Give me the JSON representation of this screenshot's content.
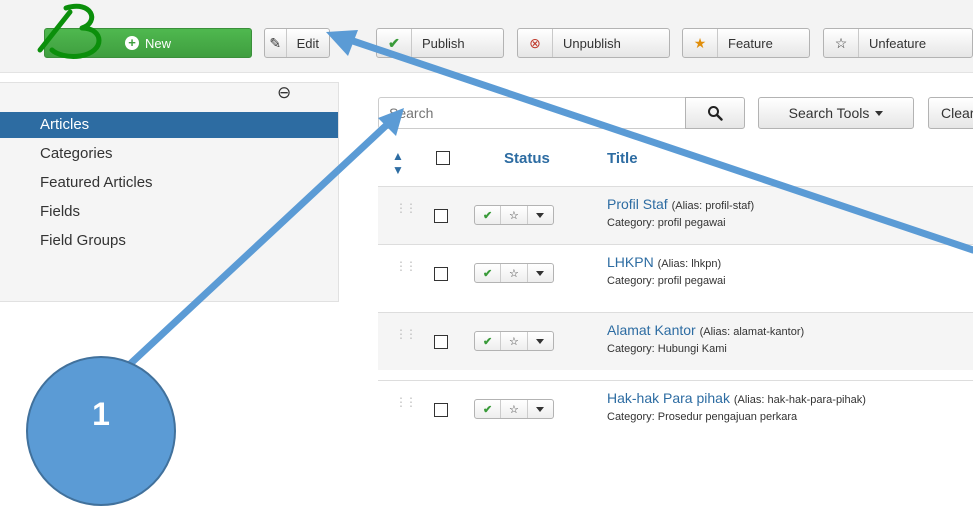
{
  "toolbar": {
    "new_label": "New",
    "edit_label": "Edit",
    "publish_label": "Publish",
    "unpublish_label": "Unpublish",
    "feature_label": "Feature",
    "unfeature_label": "Unfeature"
  },
  "sidebar": {
    "items": [
      {
        "label": "Articles",
        "active": true
      },
      {
        "label": "Categories"
      },
      {
        "label": "Featured Articles"
      },
      {
        "label": "Fields"
      },
      {
        "label": "Field Groups"
      }
    ]
  },
  "search": {
    "placeholder": "Search",
    "tools_label": "Search Tools",
    "clear_label": "Clear"
  },
  "table": {
    "headers": {
      "status": "Status",
      "title": "Title"
    },
    "rows": [
      {
        "title": "Profil Staf",
        "alias": "(Alias: profil-staf)",
        "category": "Category: profil pegawai"
      },
      {
        "title": "LHKPN",
        "alias": "(Alias: lhkpn)",
        "category": "Category: profil pegawai"
      },
      {
        "title": "Alamat Kantor",
        "alias": "(Alias: alamat-kantor)",
        "category": "Category: Hubungi Kami"
      },
      {
        "title": "Hak-hak Para pihak",
        "alias": "(Alias: hak-hak-para-pihak)",
        "category": "Category: Prosedur pengajuan perkara"
      }
    ]
  },
  "annotations": {
    "callout_number": "1",
    "handwritten_letter": "B",
    "arrow_color": "#5b9bd5"
  },
  "colors": {
    "new_button": "#46a546",
    "sidebar_active": "#2d6ca2",
    "link": "#2d6ca2"
  }
}
